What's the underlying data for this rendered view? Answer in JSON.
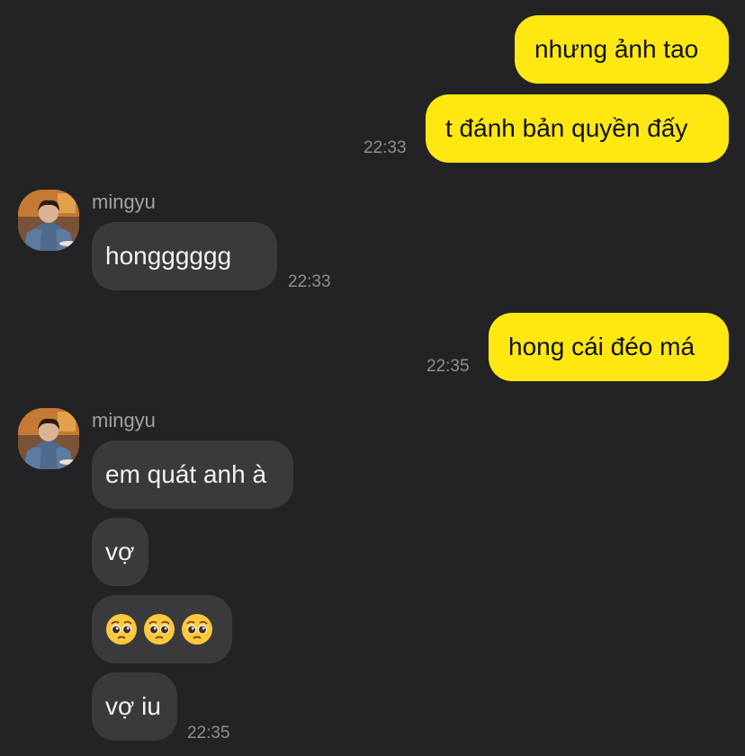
{
  "messages": [
    {
      "side": "out",
      "text": "nhưng ảnh tao"
    },
    {
      "side": "out",
      "text": "t đánh bản quyền đấy",
      "time": "22:33"
    },
    {
      "side": "in",
      "sender": "mingyu",
      "text": "hongggggg",
      "time": "22:33"
    },
    {
      "side": "out",
      "text": "hong cái đéo má",
      "time": "22:35"
    },
    {
      "side": "in",
      "sender": "mingyu",
      "text": "em quát anh à"
    },
    {
      "side": "in",
      "text": "vợ"
    },
    {
      "side": "in",
      "emoji": "pleading-face",
      "count": 3
    },
    {
      "side": "in",
      "text": "vợ iu",
      "time": "22:35"
    }
  ],
  "colors": {
    "background": "#232325",
    "outgoing_bubble": "#FFE812",
    "incoming_bubble": "#3A3A3C",
    "timestamp": "#8E8E93"
  }
}
